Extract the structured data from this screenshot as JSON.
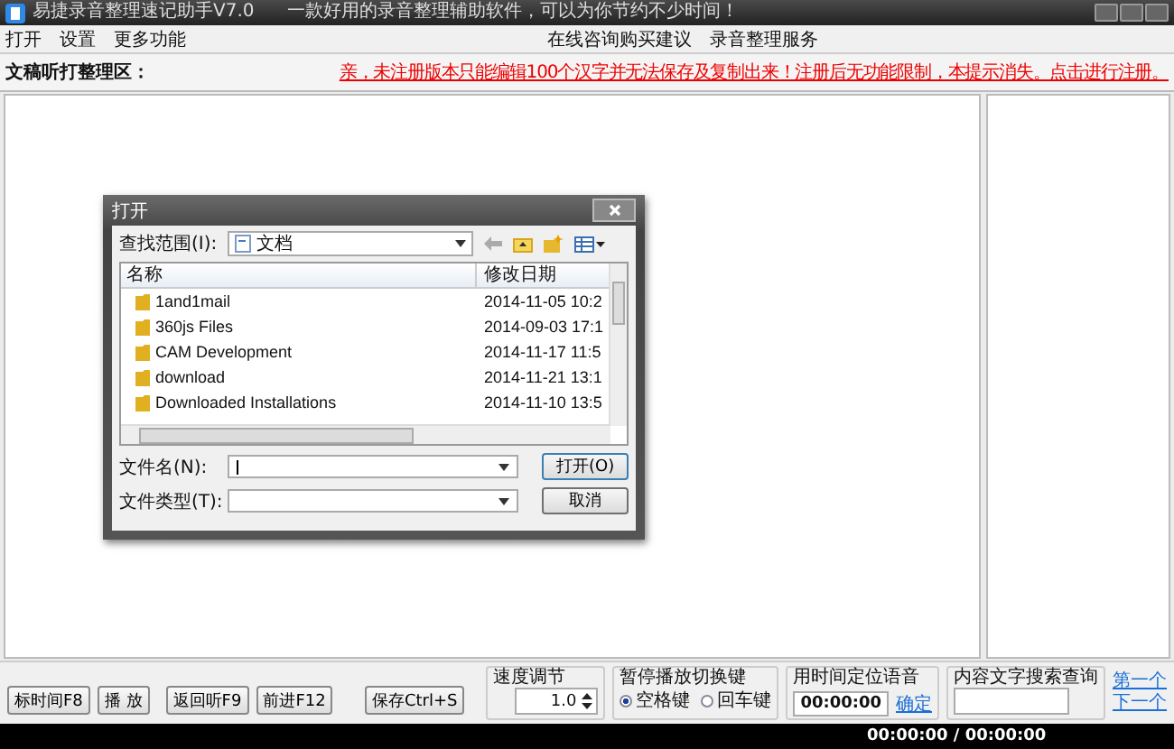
{
  "window": {
    "title": "易捷录音整理速记助手V7.0",
    "slogan": "一款好用的录音整理辅助软件，可以为你节约不少时间！"
  },
  "menu": {
    "left": [
      "打开",
      "设置",
      "更多功能"
    ],
    "right": [
      "在线咨询购买建议",
      "录音整理服务"
    ]
  },
  "header": {
    "label": "文稿听打整理区：",
    "notice": "亲，未注册版本只能编辑100个汉字并无法保存及复制出来！注册后无功能限制，本提示消失。点击进行注册。"
  },
  "dialog": {
    "title": "打开",
    "look_in_label": "查找范围(I):",
    "look_in_value": "文档",
    "columns": [
      "名称",
      "修改日期"
    ],
    "rows": [
      {
        "name": "1and1mail",
        "date": "2014-11-05 10:2"
      },
      {
        "name": "360js Files",
        "date": "2014-09-03 17:1"
      },
      {
        "name": "CAM Development",
        "date": "2014-11-17 11:5"
      },
      {
        "name": "download",
        "date": "2014-11-21 13:1"
      },
      {
        "name": "Downloaded Installations",
        "date": "2014-11-10 13:5"
      }
    ],
    "filename_label": "文件名(N):",
    "filetype_label": "文件类型(T):",
    "open_button": "打开(O)",
    "cancel_button": "取消"
  },
  "controls": {
    "buttons": [
      "标时间F8",
      "播 放",
      "返回听F9",
      "前进F12"
    ],
    "save_button": "保存Ctrl+S",
    "speed": {
      "label": "速度调节",
      "value": "1.0"
    },
    "toggle": {
      "label": "暂停播放切换键",
      "options": [
        {
          "label": "空格键",
          "selected": true
        },
        {
          "label": "回车键",
          "selected": false
        }
      ]
    },
    "locate": {
      "label": "用时间定位语音",
      "value": "00:00:00",
      "link": "确定"
    },
    "search": {
      "label": "内容文字搜索查询",
      "links": [
        "第一个",
        "下一个"
      ]
    }
  },
  "status_bar": {
    "time": "00:00:00 / 00:00:00"
  }
}
